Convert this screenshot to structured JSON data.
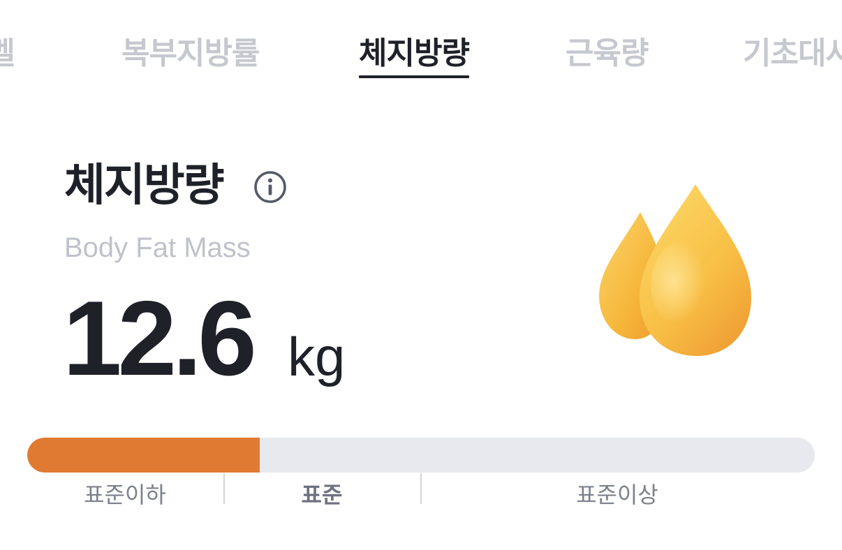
{
  "tabs": [
    {
      "label": "레벨",
      "active": false
    },
    {
      "label": "복부지방률",
      "active": false
    },
    {
      "label": "체지방량",
      "active": true
    },
    {
      "label": "근육량",
      "active": false
    },
    {
      "label": "기초대사",
      "active": false
    }
  ],
  "metric": {
    "title": "체지방량",
    "subtitle": "Body Fat Mass",
    "value": "12.6",
    "unit": "kg",
    "info_icon": "info-circle-icon",
    "illustration": "oil-drops-icon"
  },
  "range": {
    "labels": [
      "표준이하",
      "표준",
      "표준이상"
    ],
    "current_label": "표준",
    "fill_fraction": 0.295,
    "fill_color": "#e07a32",
    "track_color": "#e8e9ee"
  }
}
